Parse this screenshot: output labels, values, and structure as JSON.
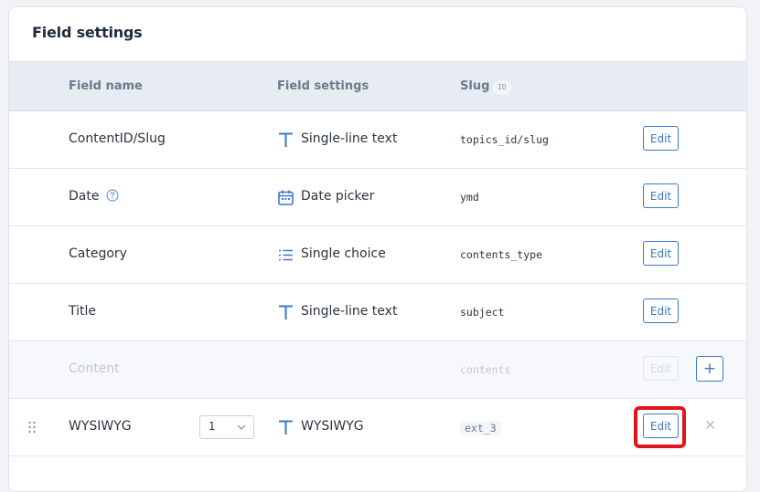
{
  "card": {
    "title": "Field settings"
  },
  "table": {
    "headers": {
      "name": "Field name",
      "settings": "Field settings",
      "slug": "Slug",
      "id_badge": "ID"
    },
    "rows": [
      {
        "name": "ContentID/Slug",
        "type": "Single-line text",
        "type_icon": "text-t-icon",
        "slug": "topics_id/slug",
        "edit": "Edit"
      },
      {
        "name": "Date",
        "type": "Date picker",
        "type_icon": "calendar-icon",
        "slug": "ymd",
        "edit": "Edit",
        "help_icon": "question-circle-icon"
      },
      {
        "name": "Category",
        "type": "Single choice",
        "type_icon": "list-icon",
        "slug": "contents_type",
        "edit": "Edit"
      },
      {
        "name": "Title",
        "type": "Single-line text",
        "type_icon": "text-t-icon",
        "slug": "subject",
        "edit": "Edit"
      },
      {
        "name": "Content",
        "type": "",
        "slug": "contents",
        "edit": "Edit",
        "add": "+",
        "disabled": true
      },
      {
        "name": "WYSIWYG",
        "select_value": "1",
        "type": "WYSIWYG",
        "type_icon": "text-t-icon",
        "slug": "ext_3",
        "edit": "Edit",
        "remove": "×"
      }
    ]
  },
  "colors": {
    "accent": "#3b79c6",
    "highlight": "#e0141a",
    "header_bg": "#e7ecf3"
  }
}
